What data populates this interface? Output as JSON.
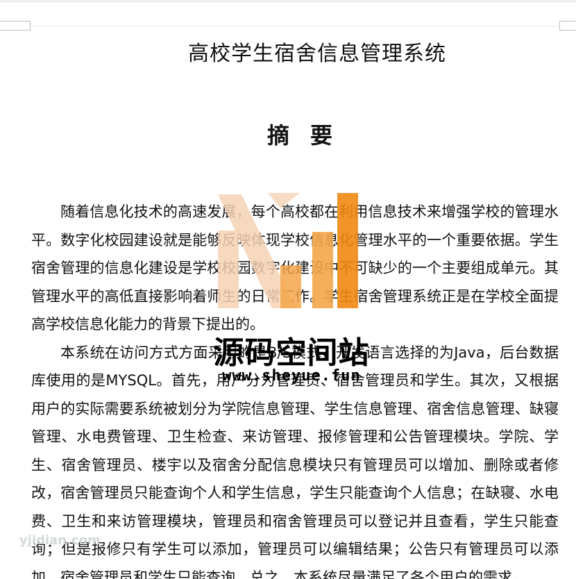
{
  "document": {
    "title": "高校学生宿舍信息管理系统",
    "abstract_heading": "摘要",
    "paragraphs": [
      "随着信息化技术的高速发展，每个高校都在利用信息技术来增强学校的管理水平。数字化校园建设就是能够反映体现学校信息化管理水平的一个重要依据。学生宿舍管理的信息化建设是学校校园数字化建设中不可缺少的一个主要组成单元。其管理水平的高低直接影响着师生的日常工作。学生宿舍管理系统正是在学校全面提高学校信息化能力的背景下提出的。",
      "本系统在访问方式方面采用的是B/S模式，开发语言选择的为Java，后台数据库使用的是MYSQL。首先，用户分为管理员、宿舍管理员和学生。其次，又根据用户的实际需要系统被划分为学院信息管理、学生信息管理、宿舍信息管理、缺寝管理、水电费管理、卫生检查、来访管理、报修管理和公告管理模块。学院、学生、宿舍管理员、楼宇以及宿舍分配信息模块只有管理员可以增加、删除或者修改，宿舍管理员只能查询个人和学生信息，学生只能查询个人信息；在缺寝、水电费、卫生和来访管理模块，管理员和宿舍管理员可以登记并且查看，学生只能查询；但是报修只有学生可以添加，管理员可以编辑结果；公告只有管理员可以添加，宿舍管理员和学生只能查询。总之，本系统尽量满足了各个用户的需求。"
    ]
  },
  "watermark": {
    "name": "源码空间站",
    "url": "www.sheyue.fun",
    "corner_text": "yjidian.com",
    "colors": {
      "bar_light": "#f6d2b4",
      "bar_mid": "#f4a64a",
      "bar_dark": "#f08a14"
    }
  }
}
